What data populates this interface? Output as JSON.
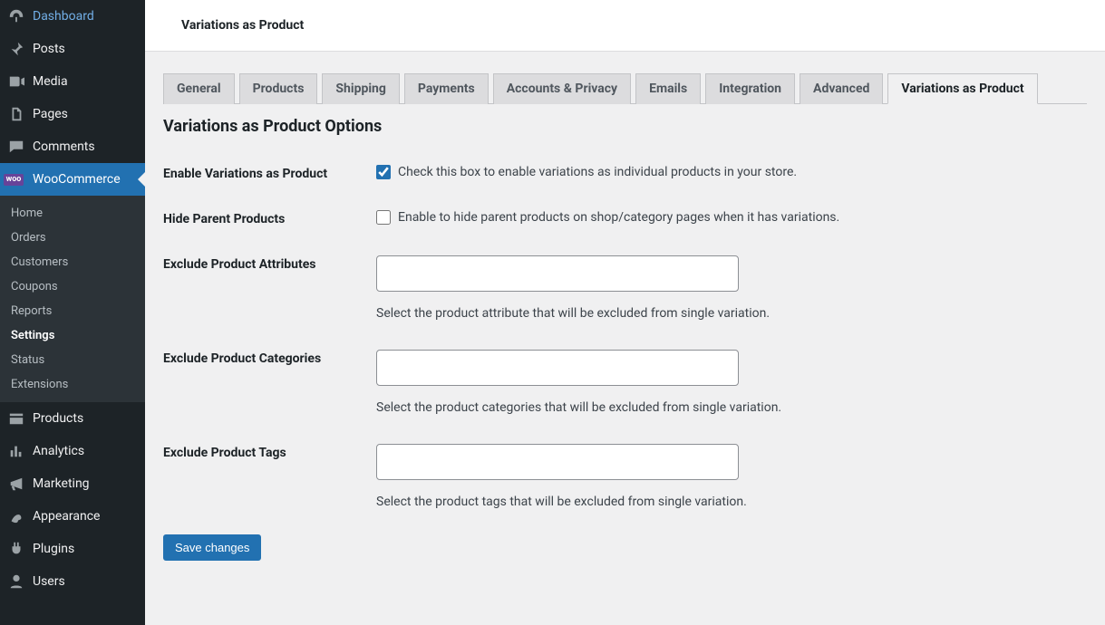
{
  "sidebar": {
    "items": [
      {
        "label": "Dashboard",
        "icon": "dashboard"
      },
      {
        "label": "Posts",
        "icon": "pin"
      },
      {
        "label": "Media",
        "icon": "media"
      },
      {
        "label": "Pages",
        "icon": "pages"
      },
      {
        "label": "Comments",
        "icon": "comments"
      },
      {
        "label": "WooCommerce",
        "icon": "woo",
        "active": true,
        "sub": [
          "Home",
          "Orders",
          "Customers",
          "Coupons",
          "Reports",
          "Settings",
          "Status",
          "Extensions"
        ],
        "current": "Settings"
      },
      {
        "label": "Products",
        "icon": "products"
      },
      {
        "label": "Analytics",
        "icon": "analytics"
      },
      {
        "label": "Marketing",
        "icon": "marketing"
      },
      {
        "label": "Appearance",
        "icon": "appearance"
      },
      {
        "label": "Plugins",
        "icon": "plugins"
      },
      {
        "label": "Users",
        "icon": "users"
      }
    ]
  },
  "header": {
    "title": "Variations as Product"
  },
  "tabs": [
    "General",
    "Products",
    "Shipping",
    "Payments",
    "Accounts & Privacy",
    "Emails",
    "Integration",
    "Advanced",
    "Variations as Product"
  ],
  "active_tab": "Variations as Product",
  "section_title": "Variations as Product Options",
  "form": {
    "enable": {
      "label": "Enable Variations as Product",
      "desc": "Check this box to enable variations as individual products in your store.",
      "checked": true
    },
    "hide_parent": {
      "label": "Hide Parent Products",
      "desc": "Enable to hide parent products on shop/category pages when it has variations.",
      "checked": false
    },
    "exclude_attrs": {
      "label": "Exclude Product Attributes",
      "value": "",
      "help": "Select the product attribute that will be excluded from single variation."
    },
    "exclude_cats": {
      "label": "Exclude Product Categories",
      "value": "",
      "help": "Select the product categories that will be excluded from single variation."
    },
    "exclude_tags": {
      "label": "Exclude Product Tags",
      "value": "",
      "help": "Select the product tags that will be excluded from single variation."
    }
  },
  "save_button": "Save changes"
}
